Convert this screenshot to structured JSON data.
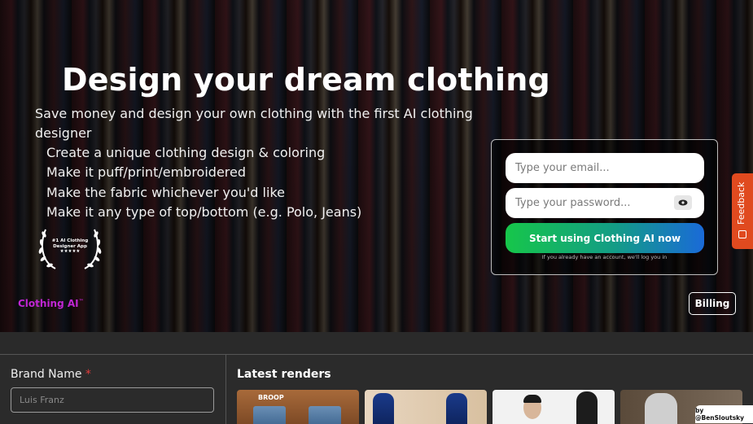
{
  "hero": {
    "title": "Design your dream clothing",
    "subtitle": "Save money and design your own clothing with the first AI clothing designer",
    "features": [
      "Create a unique clothing design & coloring",
      "Make it puff/print/embroidered",
      "Make the fabric whichever you'd like",
      "Make it any type of top/bottom (e.g. Polo, Jeans)"
    ],
    "award": {
      "line1": "#1 AI Clothing",
      "line2": "Designer App",
      "stars": "★★★★★"
    }
  },
  "login": {
    "email_placeholder": "Type your email...",
    "password_placeholder": "Type your password...",
    "cta_label": "Start using Clothing AI now",
    "note": "If you already have an account, we'll log you in"
  },
  "brand": {
    "name": "Clothing AI",
    "tm": "™"
  },
  "billing_label": "Billing",
  "feedback_label": "Feedback",
  "form": {
    "brand_label": "Brand Name",
    "required_mark": "*",
    "brand_placeholder": "Luis Franz"
  },
  "latest": {
    "title": "Latest renders",
    "render1_text": "BROOP"
  },
  "credit": "by @BenSloutsky",
  "colors": {
    "accent_purple": "#c026d3",
    "cta_green": "#16c64a",
    "cta_blue": "#1a6ad8",
    "feedback_orange": "#e04a1f",
    "required_red": "#e03b3b"
  }
}
